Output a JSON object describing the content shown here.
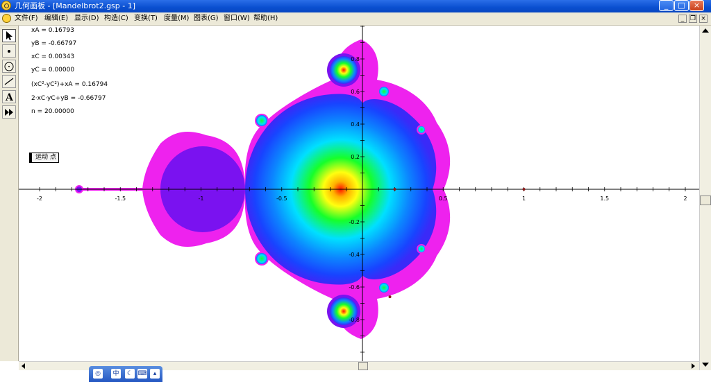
{
  "window": {
    "title": "几何画板 - [Mandelbrot2.gsp - 1]",
    "min_label": "_",
    "max_label": "□",
    "close_label": "×"
  },
  "menu": {
    "items": [
      "文件(F)",
      "编辑(E)",
      "显示(D)",
      "构造(C)",
      "变换(T)",
      "度量(M)",
      "图表(G)",
      "窗口(W)",
      "帮助(H)"
    ],
    "mdi_min": "_",
    "mdi_restore": "❐",
    "mdi_close": "×"
  },
  "tools": [
    "pointer-tool",
    "point-tool",
    "compass-tool",
    "line-tool",
    "text-tool",
    "custom-tool"
  ],
  "readouts": [
    {
      "text": "xA = 0.16793"
    },
    {
      "text": "yB = -0.66797"
    },
    {
      "text": "xC = 0.00343"
    },
    {
      "text": "yC = 0.00000"
    },
    {
      "text": "(xC²-yC²)+xA = 0.16794"
    },
    {
      "text": "2·xC·yC+yB = -0.66797"
    },
    {
      "text": "n = 20.00000"
    }
  ],
  "animate_button": "运动 点",
  "axes": {
    "x_ticks": [
      "-2",
      "-1.5",
      "-1",
      "-0.5",
      "0.5",
      "1",
      "1.5",
      "2"
    ],
    "y_ticks": [
      "0.8",
      "0.6",
      "0.4",
      "0.2",
      "-0.2",
      "-0.4",
      "-0.6",
      "-0.8"
    ]
  },
  "ime": {
    "label": "中"
  },
  "colors": {
    "outer": "#ee22ee",
    "set_purple": "#7a12f0",
    "blue": "#1844ff",
    "cyan": "#00e0ff",
    "green": "#16ff2a",
    "yellow": "#ffff10",
    "red": "#ff1200"
  }
}
